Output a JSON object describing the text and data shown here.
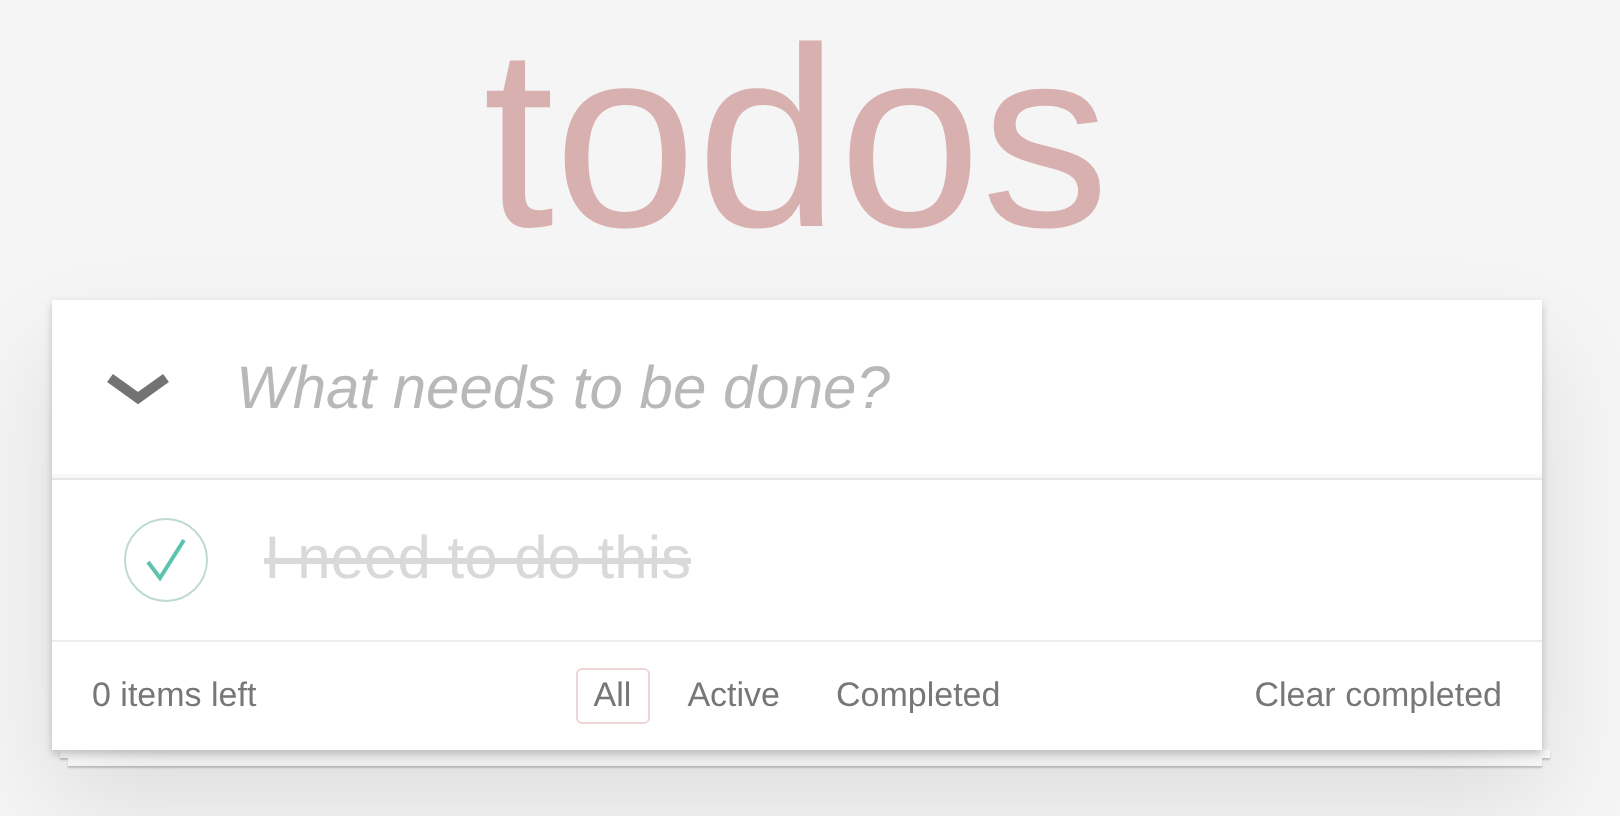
{
  "title": "todos",
  "new_todo": {
    "placeholder": "What needs to be done?",
    "toggle_all_checked": true
  },
  "todos": [
    {
      "text": "I need to do this",
      "completed": true
    }
  ],
  "footer": {
    "count": "0 items left",
    "filters": [
      {
        "label": "All",
        "selected": true
      },
      {
        "label": "Active",
        "selected": false
      },
      {
        "label": "Completed",
        "selected": false
      }
    ],
    "clear": "Clear completed"
  }
}
